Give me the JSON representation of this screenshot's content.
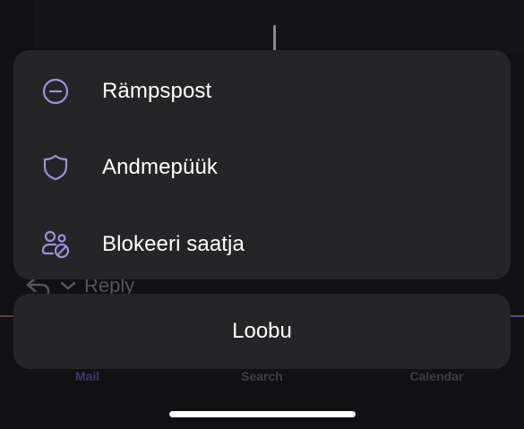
{
  "background": {
    "reply_label": "Reply",
    "tabs": [
      {
        "label": "Mail"
      },
      {
        "label": "Search"
      },
      {
        "label": "Calendar"
      }
    ]
  },
  "action_sheet": {
    "items": [
      {
        "label": "Rämpspost",
        "icon": "minus-circle-icon"
      },
      {
        "label": "Andmepüük",
        "icon": "shield-icon"
      },
      {
        "label": "Blokeeri saatja",
        "icon": "block-people-icon"
      }
    ],
    "cancel_label": "Loobu"
  },
  "colors": {
    "accent": "#9f8fe0",
    "sheet_bg": "#252527",
    "text": "#ffffff"
  }
}
